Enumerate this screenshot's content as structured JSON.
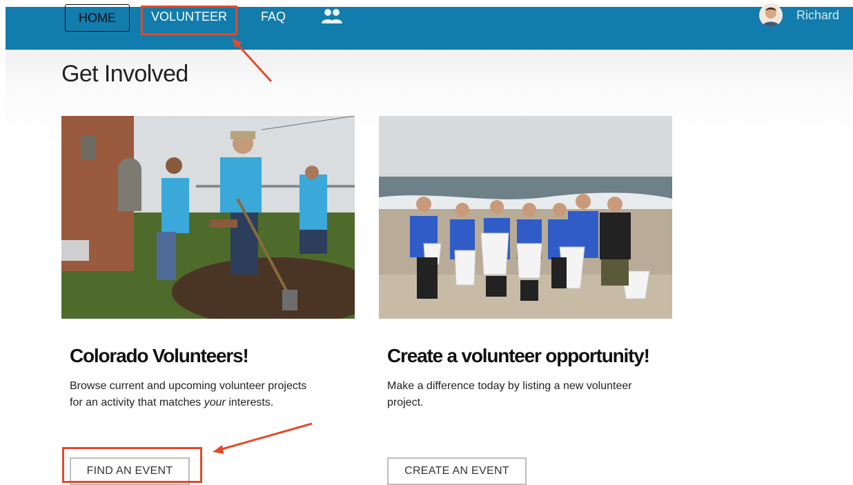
{
  "nav": {
    "home_label": "HOME",
    "volunteer_label": "VOLUNTEER",
    "faq_label": "FAQ",
    "community_icon": "users-icon",
    "user_name": "Richard"
  },
  "page": {
    "title": "Get Involved"
  },
  "cards": [
    {
      "title": "Colorado Volunteers!",
      "desc_before": "Browse current and upcoming volunteer projects for an activity that matches ",
      "desc_emphasis": "your",
      "desc_after": " interests.",
      "button_label": "FIND AN EVENT"
    },
    {
      "title": "Create a volunteer opportunity!",
      "desc": "Make a difference today by listing a new volunteer project.",
      "button_label": "CREATE AN EVENT"
    }
  ],
  "colors": {
    "navbar": "#127cac",
    "annotation": "#e44a2a",
    "button_border": "#bdbdbd"
  }
}
